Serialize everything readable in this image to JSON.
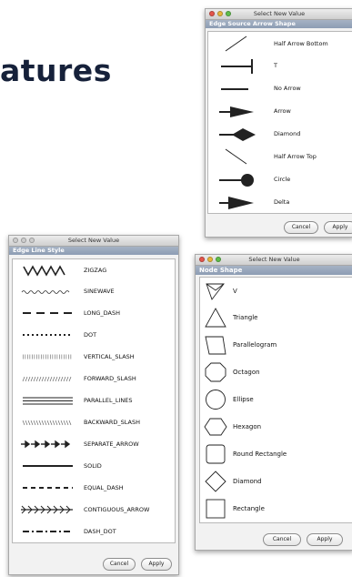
{
  "slide_title": "atures",
  "arrow_dialog": {
    "window_title": "Select New Value",
    "header": "Edge Source Arrow Shape",
    "items": [
      {
        "label": "Half Arrow Bottom",
        "icon": "half-arrow-bottom-icon"
      },
      {
        "label": "T",
        "icon": "t-arrow-icon"
      },
      {
        "label": "No Arrow",
        "icon": "no-arrow-icon"
      },
      {
        "label": "Arrow",
        "icon": "arrow-icon"
      },
      {
        "label": "Diamond",
        "icon": "diamond-arrow-icon"
      },
      {
        "label": "Half Arrow Top",
        "icon": "half-arrow-top-icon"
      },
      {
        "label": "Circle",
        "icon": "circle-arrow-icon"
      },
      {
        "label": "Delta",
        "icon": "delta-arrow-icon"
      }
    ],
    "cancel_label": "Cancel",
    "apply_label": "Apply"
  },
  "line_dialog": {
    "window_title": "Select New Value",
    "header": "Edge Line Style",
    "items": [
      {
        "label": "ZIGZAG",
        "icon": "zigzag-line-icon"
      },
      {
        "label": "SINEWAVE",
        "icon": "sinewave-line-icon"
      },
      {
        "label": "LONG_DASH",
        "icon": "long-dash-line-icon"
      },
      {
        "label": "DOT",
        "icon": "dot-line-icon"
      },
      {
        "label": "VERTICAL_SLASH",
        "icon": "vertical-slash-line-icon"
      },
      {
        "label": "FORWARD_SLASH",
        "icon": "forward-slash-line-icon"
      },
      {
        "label": "PARALLEL_LINES",
        "icon": "parallel-lines-icon"
      },
      {
        "label": "BACKWARD_SLASH",
        "icon": "backward-slash-line-icon"
      },
      {
        "label": "SEPARATE_ARROW",
        "icon": "separate-arrow-line-icon"
      },
      {
        "label": "SOLID",
        "icon": "solid-line-icon"
      },
      {
        "label": "EQUAL_DASH",
        "icon": "equal-dash-line-icon"
      },
      {
        "label": "CONTIGUOUS_ARROW",
        "icon": "contiguous-arrow-line-icon"
      },
      {
        "label": "DASH_DOT",
        "icon": "dash-dot-line-icon"
      }
    ],
    "cancel_label": "Cancel",
    "apply_label": "Apply"
  },
  "node_dialog": {
    "window_title": "Select New Value",
    "header": "Node Shape",
    "items": [
      {
        "label": "V",
        "icon": "v-shape-icon"
      },
      {
        "label": "Triangle",
        "icon": "triangle-shape-icon"
      },
      {
        "label": "Parallelogram",
        "icon": "parallelogram-shape-icon"
      },
      {
        "label": "Octagon",
        "icon": "octagon-shape-icon"
      },
      {
        "label": "Ellipse",
        "icon": "ellipse-shape-icon"
      },
      {
        "label": "Hexagon",
        "icon": "hexagon-shape-icon"
      },
      {
        "label": "Round Rectangle",
        "icon": "round-rectangle-shape-icon"
      },
      {
        "label": "Diamond",
        "icon": "diamond-shape-icon"
      },
      {
        "label": "Rectangle",
        "icon": "rectangle-shape-icon"
      }
    ],
    "cancel_label": "Cancel",
    "apply_label": "Apply"
  },
  "colors": {
    "header_bg": "#95a3b8",
    "title_text": "#16213a",
    "close_light": "#e4554b"
  }
}
